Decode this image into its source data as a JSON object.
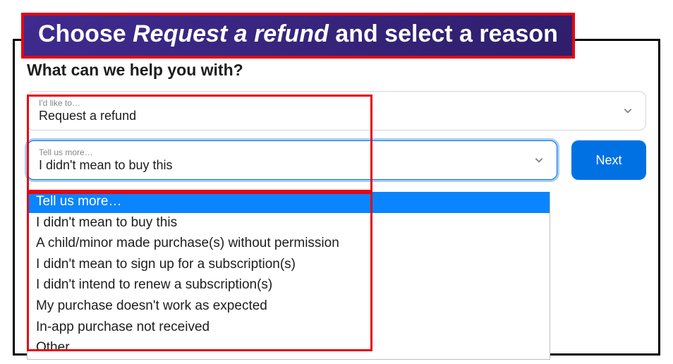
{
  "banner": {
    "prefix": "Choose ",
    "italic": "Request a refund",
    "suffix": " and select a reason"
  },
  "heading": "What can we help you with?",
  "select_action": {
    "label": "I'd like to…",
    "value": "Request a refund"
  },
  "select_reason": {
    "label": "Tell us more…",
    "value": "I didn't mean to buy this"
  },
  "next_label": "Next",
  "dropdown_options": [
    "Tell us more…",
    "I didn't mean to buy this",
    "A child/minor made purchase(s) without permission",
    "I didn't mean to sign up for a subscription(s)",
    "I didn't intend to renew a subscription(s)",
    "My purchase doesn't work as expected",
    "In-app purchase not received",
    "Other"
  ],
  "colors": {
    "accent": "#0071e3",
    "highlight_red": "#e30613",
    "banner_bg": "#3f2b8f"
  }
}
